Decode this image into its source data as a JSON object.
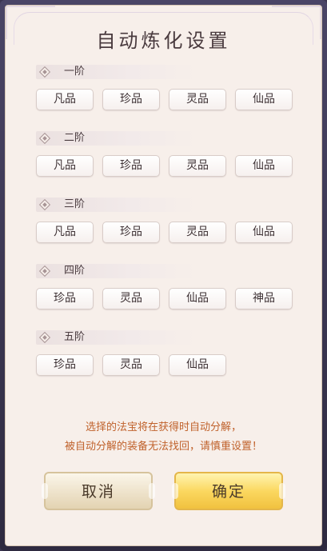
{
  "dialog": {
    "title": "自动炼化设置",
    "notice_line1": "选择的法宝将在获得时自动分解，",
    "notice_line2": "被自动分解的装备无法找回，请慎重设置！",
    "cancel_label": "取消",
    "confirm_label": "确定"
  },
  "tiers": [
    {
      "label": "一阶",
      "options": [
        "凡品",
        "珍品",
        "灵品",
        "仙品"
      ]
    },
    {
      "label": "二阶",
      "options": [
        "凡品",
        "珍品",
        "灵品",
        "仙品"
      ]
    },
    {
      "label": "三阶",
      "options": [
        "凡品",
        "珍品",
        "灵品",
        "仙品"
      ]
    },
    {
      "label": "四阶",
      "options": [
        "珍品",
        "灵品",
        "仙品",
        "神品"
      ]
    },
    {
      "label": "五阶",
      "options": [
        "珍品",
        "灵品",
        "仙品"
      ]
    }
  ],
  "colors": {
    "panel_bg": "#f7efea",
    "notice_text": "#c0622c",
    "confirm_button": "#f1c23f",
    "cancel_button": "#efe4cd"
  }
}
